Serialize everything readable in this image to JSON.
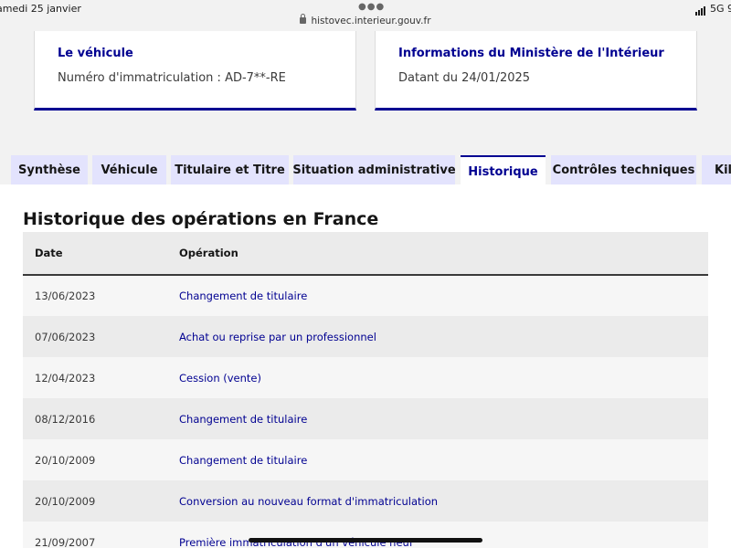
{
  "status_bar": {
    "time": "amedi 25 janvier",
    "url": "histovec.interieur.gouv.fr",
    "network": "5G",
    "battery": "9"
  },
  "cards": [
    {
      "title": "Le véhicule",
      "text": "Numéro d'immatriculation : AD-7**-RE"
    },
    {
      "title": "Informations du Ministère de l'Intérieur",
      "text": "Datant du 24/01/2025"
    }
  ],
  "tabs": [
    {
      "label": "Synthèse",
      "active": false
    },
    {
      "label": "Véhicule",
      "active": false
    },
    {
      "label": "Titulaire et Titre",
      "active": false
    },
    {
      "label": "Situation administrative",
      "active": false
    },
    {
      "label": "Historique",
      "active": true
    },
    {
      "label": "Contrôles techniques",
      "active": false
    },
    {
      "label": "Kilo",
      "active": false
    }
  ],
  "history": {
    "title": "Historique des opérations en France",
    "columns": [
      "Date",
      "Opération"
    ],
    "rows": [
      {
        "date": "13/06/2023",
        "operation": "Changement de titulaire"
      },
      {
        "date": "07/06/2023",
        "operation": "Achat ou reprise par un professionnel"
      },
      {
        "date": "12/04/2023",
        "operation": "Cession (vente)"
      },
      {
        "date": "08/12/2016",
        "operation": "Changement de titulaire"
      },
      {
        "date": "20/10/2009",
        "operation": "Changement de titulaire"
      },
      {
        "date": "20/10/2009",
        "operation": "Conversion au nouveau format d'immatriculation"
      },
      {
        "date": "21/09/2007",
        "operation": "Première immatriculation d'un véhicule neuf"
      }
    ]
  },
  "colors": {
    "accent": "#000091",
    "tab_bg": "#e3e3fd"
  }
}
